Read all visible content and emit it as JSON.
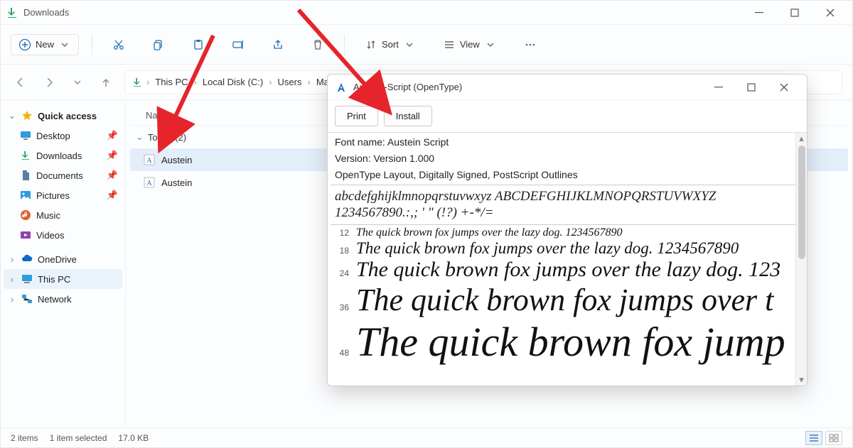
{
  "explorer": {
    "title": "Downloads",
    "toolbar": {
      "new_label": "New",
      "sort_label": "Sort",
      "view_label": "View"
    },
    "breadcrumb": [
      "This PC",
      "Local Disk (C:)",
      "Users",
      "Malavida"
    ],
    "sidebar": {
      "quick_access": "Quick access",
      "items": [
        {
          "label": "Desktop"
        },
        {
          "label": "Downloads"
        },
        {
          "label": "Documents"
        },
        {
          "label": "Pictures"
        },
        {
          "label": "Music"
        },
        {
          "label": "Videos"
        }
      ],
      "onedrive": "OneDrive",
      "this_pc": "This PC",
      "network": "Network"
    },
    "filepane": {
      "column_header": "Name",
      "group_label": "Today (2)",
      "files": [
        {
          "name": "Austein"
        },
        {
          "name": "Austein"
        }
      ]
    },
    "statusbar": {
      "items": "2 items",
      "selected": "1 item selected",
      "size": "17.0 KB"
    }
  },
  "popup": {
    "title": "Austein-Script (OpenType)",
    "print_label": "Print",
    "install_label": "Install",
    "meta": {
      "font_name": "Font name: Austein Script",
      "version": "Version: Version 1.000",
      "layout": "OpenType Layout, Digitally Signed, PostScript Outlines"
    },
    "alpha_line1": "abcdefghijklmnopqrstuvwxyz ABCDEFGHIJKLMNOPQRSTUVWXYZ",
    "alpha_line2": "1234567890.:,; ' \" (!?) +-*/=",
    "samples": [
      {
        "size": "12",
        "text": "The quick brown fox jumps over the lazy dog. 1234567890",
        "px": 16
      },
      {
        "size": "18",
        "text": "The quick brown fox jumps over the lazy dog. 1234567890",
        "px": 23
      },
      {
        "size": "24",
        "text": "The quick brown fox jumps over the lazy dog. 123",
        "px": 30
      },
      {
        "size": "36",
        "text": "The quick brown fox jumps over t",
        "px": 44
      },
      {
        "size": "48",
        "text": "The quick brown fox jump",
        "px": 58
      }
    ]
  }
}
